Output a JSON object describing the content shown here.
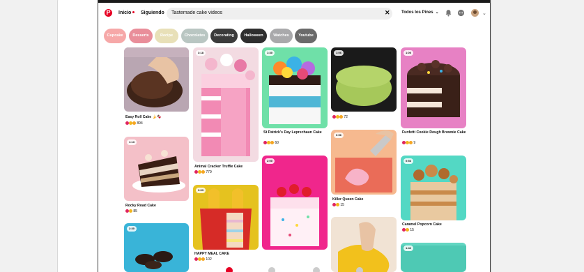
{
  "nav": {
    "home_label": "Inicio",
    "following_label": "Siguiendo",
    "search_value": "Tastemade cake videos",
    "filter_label": "Todos los Pines"
  },
  "chips": [
    {
      "label": "Cupcake",
      "color": "#f6a8a8"
    },
    {
      "label": "Desserts",
      "color": "#e98e9a"
    },
    {
      "label": "Recipe",
      "color": "#e8e0b8"
    },
    {
      "label": "Chocolates",
      "color": "#b9c6c2"
    },
    {
      "label": "Decorating",
      "color": "#3b3b3b"
    },
    {
      "label": "Halloween",
      "color": "#2e2e2e"
    },
    {
      "label": "Watches",
      "color": "#a9a9ab"
    },
    {
      "label": "Youtube",
      "color": "#6a6a6a"
    }
  ],
  "pins": [
    {
      "title": "Easy Roll Cake 🍌🍫",
      "reactions": "894",
      "badge": ""
    },
    {
      "title": "Rocky Road Cake",
      "reactions": "85",
      "badge": "1:13"
    },
    {
      "title": "",
      "reactions": "",
      "badge": "2:30"
    },
    {
      "title": "Animal Cracker Truffle Cake",
      "reactions": "779",
      "badge": "3:18"
    },
    {
      "title": "HAPPY MEAL CAKE",
      "reactions": "102",
      "badge": "3:03"
    },
    {
      "title": "St Patrick's Day Leprechaun Cake",
      "reactions": "60",
      "badge": "1:30"
    },
    {
      "title": "",
      "reactions": "",
      "badge": "2:00"
    },
    {
      "title": "",
      "reactions": "72",
      "badge": "1:06"
    },
    {
      "title": "Killer Queen Cake",
      "reactions": "15",
      "badge": "0:56"
    },
    {
      "title": "",
      "reactions": "",
      "badge": ""
    },
    {
      "title": "Funfetti Cookie Dough Brownie Cake",
      "reactions": "9",
      "badge": "1:00"
    },
    {
      "title": "Caramel Popcorn Cake",
      "reactions": "15",
      "badge": "0:53"
    },
    {
      "title": "",
      "reactions": "",
      "badge": "1:42"
    }
  ],
  "colors": {
    "brand": "#e60023",
    "react_heart": "#e0245e",
    "react_wow": "#f2b51c"
  }
}
